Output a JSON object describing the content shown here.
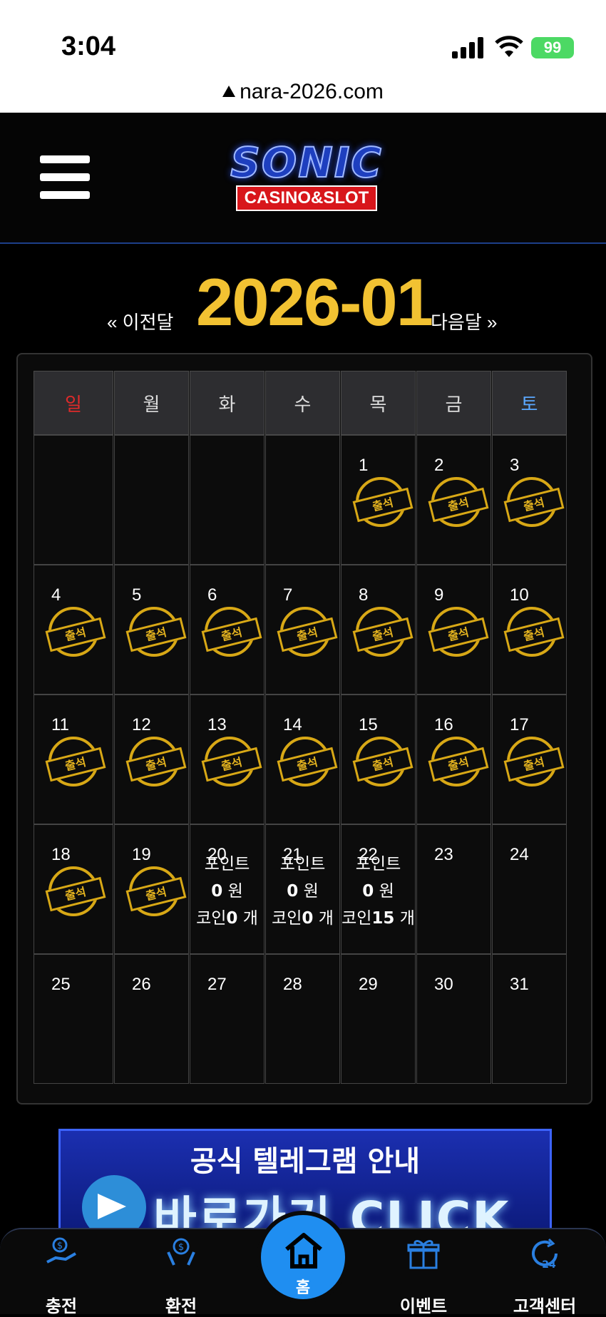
{
  "status_bar": {
    "time": "3:04",
    "battery": "99",
    "url": "nara-2026.com"
  },
  "header": {
    "logo_main": "SONIC",
    "logo_sub": "CASINO&SLOT"
  },
  "calendar": {
    "month": "2026-01",
    "prev_label": "« 이전달",
    "next_label": "다음달 »",
    "weekdays": [
      "일",
      "월",
      "화",
      "수",
      "목",
      "금",
      "토"
    ],
    "stamp_text": "출석",
    "weeks": [
      [
        {
          "day": "",
          "stamp": false
        },
        {
          "day": "",
          "stamp": false
        },
        {
          "day": "",
          "stamp": false
        },
        {
          "day": "",
          "stamp": false
        },
        {
          "day": "1",
          "stamp": true
        },
        {
          "day": "2",
          "stamp": true
        },
        {
          "day": "3",
          "stamp": true
        }
      ],
      [
        {
          "day": "4",
          "stamp": true
        },
        {
          "day": "5",
          "stamp": true
        },
        {
          "day": "6",
          "stamp": true
        },
        {
          "day": "7",
          "stamp": true
        },
        {
          "day": "8",
          "stamp": true
        },
        {
          "day": "9",
          "stamp": true
        },
        {
          "day": "10",
          "stamp": true
        }
      ],
      [
        {
          "day": "11",
          "stamp": true
        },
        {
          "day": "12",
          "stamp": true
        },
        {
          "day": "13",
          "stamp": true
        },
        {
          "day": "14",
          "stamp": true
        },
        {
          "day": "15",
          "stamp": true
        },
        {
          "day": "16",
          "stamp": true
        },
        {
          "day": "17",
          "stamp": true
        }
      ],
      [
        {
          "day": "18",
          "stamp": true
        },
        {
          "day": "19",
          "stamp": true
        },
        {
          "day": "20",
          "stamp": false,
          "info": {
            "point_label": "포인트",
            "point_value": "0",
            "point_unit": " 원",
            "coin_label": "코인",
            "coin_value": "0",
            "coin_unit": " 개"
          }
        },
        {
          "day": "21",
          "stamp": false,
          "info": {
            "point_label": "포인트",
            "point_value": "0",
            "point_unit": " 원",
            "coin_label": "코인",
            "coin_value": "0",
            "coin_unit": " 개"
          }
        },
        {
          "day": "22",
          "stamp": false,
          "info": {
            "point_label": "포인트",
            "point_value": "0",
            "point_unit": " 원",
            "coin_label": "코인",
            "coin_value": "15",
            "coin_unit": " 개"
          }
        },
        {
          "day": "23",
          "stamp": false
        },
        {
          "day": "24",
          "stamp": false
        }
      ],
      [
        {
          "day": "25",
          "stamp": false
        },
        {
          "day": "26",
          "stamp": false
        },
        {
          "day": "27",
          "stamp": false
        },
        {
          "day": "28",
          "stamp": false
        },
        {
          "day": "29",
          "stamp": false
        },
        {
          "day": "30",
          "stamp": false
        },
        {
          "day": "31",
          "stamp": false
        }
      ]
    ]
  },
  "banner": {
    "title": "공식 텔레그램 안내",
    "cta": "바로가기 CLICK"
  },
  "tabbar": {
    "charge": "충전",
    "exchange": "환전",
    "home": "홈",
    "event": "이벤트",
    "support": "고객센터"
  }
}
